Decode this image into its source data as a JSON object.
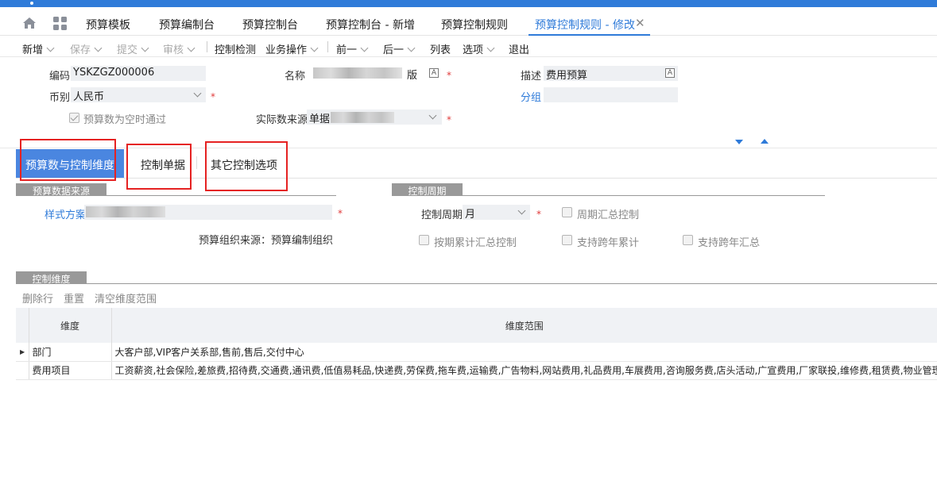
{
  "tabs": {
    "items": [
      {
        "label": "预算模板"
      },
      {
        "label": "预算编制台"
      },
      {
        "label": "预算控制台"
      },
      {
        "label": "预算控制台 - 新增"
      },
      {
        "label": "预算控制规则"
      },
      {
        "label": "预算控制规则 - 修改",
        "active": true
      }
    ],
    "close_symbol": "✕"
  },
  "toolbar": {
    "new": "新增",
    "save": "保存",
    "submit": "提交",
    "audit": "审核",
    "check": "控制检测",
    "business": "业务操作",
    "prev": "前一",
    "next": "后一",
    "list": "列表",
    "options": "选项",
    "exit": "退出"
  },
  "header": {
    "code_label": "编码",
    "code_value": "YSKZGZ000006",
    "name_label": "名称",
    "name_suffix": "版",
    "desc_label": "描述",
    "desc_value": "费用预算",
    "currency_label": "币别",
    "currency_value": "人民币",
    "group_label": "分组",
    "group_value": "",
    "pass_when_empty_label": "预算数为空时通过",
    "actual_source_label": "实际数来源",
    "actual_source_value": "单据",
    "required_mark": "*",
    "lang_icon": "A"
  },
  "pane_tabs": {
    "dims": "预算数与控制维度",
    "bills": "控制单据",
    "other": "其它控制选项"
  },
  "source_section": {
    "title": "预算数据来源",
    "scheme_label": "样式方案",
    "org_source_text": "预算组织来源：预算编制组织"
  },
  "period_section": {
    "title": "控制周期",
    "period_label": "控制周期",
    "period_value": "月",
    "period_summary": "周期汇总控制",
    "cumulative_summary": "按期累计汇总控制",
    "cross_year_cumulative": "支持跨年累计",
    "cross_year_summary": "支持跨年汇总"
  },
  "dims_section": {
    "title": "控制维度",
    "delete_row": "删除行",
    "reset": "重置",
    "clear_range": "清空维度范围",
    "col_dim": "维度",
    "col_range": "维度范围",
    "rows": [
      {
        "dim": "部门",
        "range": "大客户部,VIP客户关系部,售前,售后,交付中心"
      },
      {
        "dim": "费用项目",
        "range": "工资薪资,社会保险,差旅费,招待费,交通费,通讯费,低值易耗品,快递费,劳保费,拖车费,运输费,广告物料,网站费用,礼品费用,车展费用,咨询服务费,店头活动,广宣费用,厂家联投,维修费,租赁费,物业管理费"
      }
    ]
  },
  "colors": {
    "accent": "#2f7bd9",
    "active_tab_bg": "#4a86e0",
    "annotation_red": "#e52222",
    "section_gray": "#999999"
  }
}
